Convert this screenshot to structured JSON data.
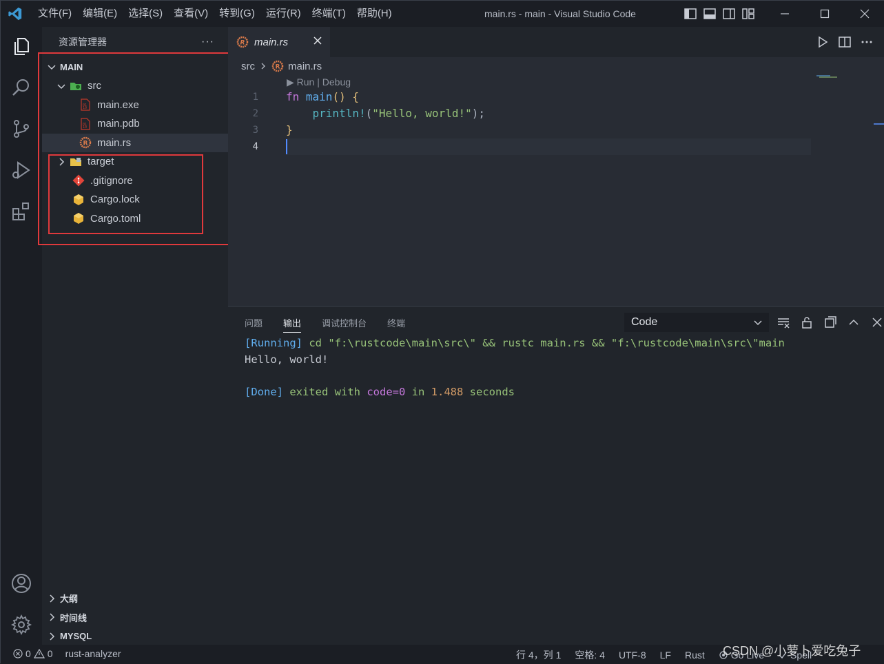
{
  "window": {
    "title": "main.rs - main - Visual Studio Code",
    "menu": [
      "文件(F)",
      "编辑(E)",
      "选择(S)",
      "查看(V)",
      "转到(G)",
      "运行(R)",
      "终端(T)",
      "帮助(H)"
    ]
  },
  "sidebar": {
    "header": "资源管理器",
    "more": "···",
    "root_section": "MAIN",
    "tree": [
      {
        "label": "src",
        "icon": "folder-src-icon",
        "indent": 1,
        "kind": "folder-open"
      },
      {
        "label": "main.exe",
        "icon": "binary-file-icon",
        "indent": 2,
        "kind": "file"
      },
      {
        "label": "main.pdb",
        "icon": "binary-file-icon",
        "indent": 2,
        "kind": "file"
      },
      {
        "label": "main.rs",
        "icon": "rust-file-icon",
        "indent": 2,
        "kind": "file",
        "selected": true
      },
      {
        "label": "target",
        "icon": "folder-icon",
        "indent": 1,
        "kind": "folder-closed"
      },
      {
        "label": ".gitignore",
        "icon": "git-icon",
        "indent": 1,
        "kind": "file"
      },
      {
        "label": "Cargo.lock",
        "icon": "cargo-icon",
        "indent": 1,
        "kind": "file"
      },
      {
        "label": "Cargo.toml",
        "icon": "cargo-icon",
        "indent": 1,
        "kind": "file"
      }
    ],
    "bottom_sections": [
      "大纲",
      "时间线",
      "MYSQL"
    ]
  },
  "editor": {
    "tab_label": "main.rs",
    "breadcrumb": {
      "folder": "src",
      "file": "main.rs"
    },
    "codelens": "▶ Run | Debug",
    "line_numbers": [
      "1",
      "2",
      "3",
      "4"
    ],
    "code": {
      "l1_kw": "fn",
      "l1_name": "main",
      "l1_rest": "() {",
      "l2_indent": "    ",
      "l2_macro": "println!",
      "l2_open": "(",
      "l2_str": "\"Hello, world!\"",
      "l2_close": ");",
      "l3": "}"
    }
  },
  "panel": {
    "tabs": [
      "问题",
      "输出",
      "调试控制台",
      "终端"
    ],
    "active_tab": "输出",
    "select_value": "Code",
    "output": {
      "running_tag": "[Running]",
      "running_cmd": " cd \"f:\\rustcode\\main\\src\\\" && rustc main.rs && \"f:\\rustcode\\main\\src\\\"main",
      "hello": "Hello, world!",
      "done_tag": "[Done]",
      "done_text1": " exited with ",
      "done_code": "code=0",
      "done_text2": " in ",
      "done_time": "1.488",
      "done_text3": " seconds"
    }
  },
  "statusbar": {
    "errors": "0",
    "warnings": "0",
    "rust_analyzer": "rust-analyzer",
    "position": "行 4，列 1",
    "spaces": "空格: 4",
    "encoding": "UTF-8",
    "eol": "LF",
    "language": "Rust",
    "go_live": "Go Live",
    "spell": "Spell"
  },
  "watermark": "CSDN @小萝卜爱吃兔子",
  "colors": {
    "accent": "#528bff",
    "annotation_red": "#e0393c",
    "keyword": "#c678dd",
    "function": "#61afef",
    "string": "#98c379"
  }
}
